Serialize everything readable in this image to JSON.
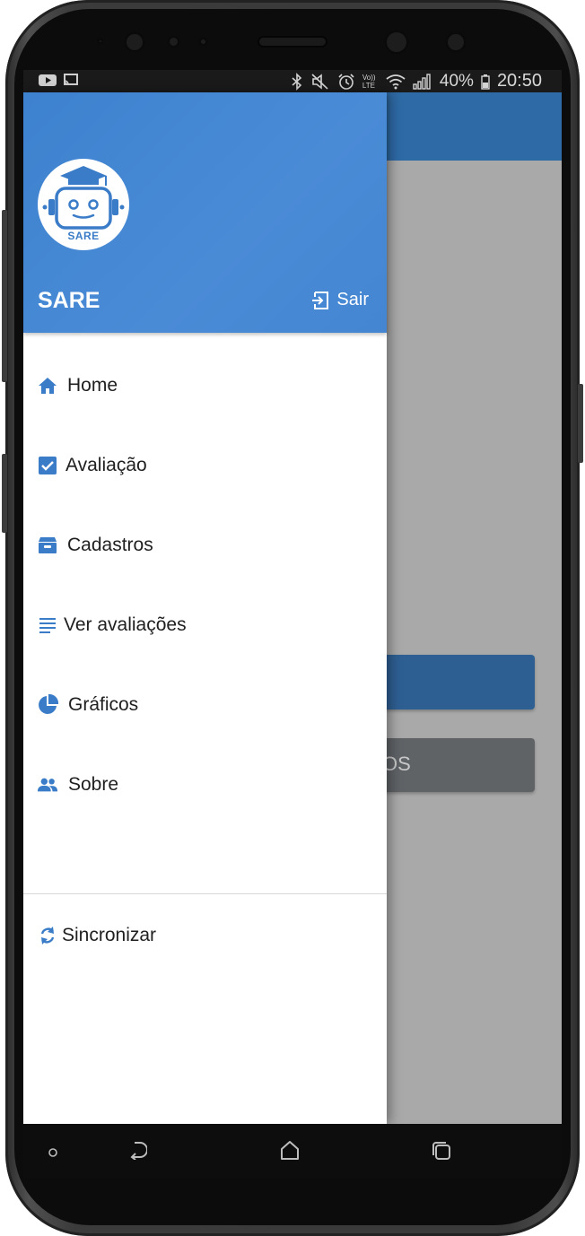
{
  "status_bar": {
    "left_icons": [
      "youtube-icon",
      "cast-icon"
    ],
    "right_icons": [
      "bluetooth-icon",
      "mute-icon",
      "alarm-icon",
      "volte-icon",
      "wifi-icon",
      "signal-icon"
    ],
    "volte_label": "Vo)) LTE",
    "battery": "40%",
    "time": "20:50"
  },
  "drawer": {
    "app_name": "SARE",
    "logo_text": "SARE",
    "logout_label": "Sair",
    "items": [
      {
        "label": "Home",
        "icon": "home-icon"
      },
      {
        "label": "Avaliação",
        "icon": "checkbox-icon"
      },
      {
        "label": "Cadastros",
        "icon": "archive-icon"
      },
      {
        "label": "Ver avaliações",
        "icon": "list-icon"
      },
      {
        "label": "Gráficos",
        "icon": "pie-chart-icon"
      },
      {
        "label": "Sobre",
        "icon": "people-icon"
      }
    ],
    "secondary_items": [
      {
        "label": "Sincronizar",
        "icon": "sync-icon"
      }
    ]
  },
  "background": {
    "gray_button_visible_text": "OS"
  },
  "colors": {
    "accent": "#4486d2",
    "icon": "#3a7cc7",
    "background_appbar": "#2e6aa5"
  }
}
